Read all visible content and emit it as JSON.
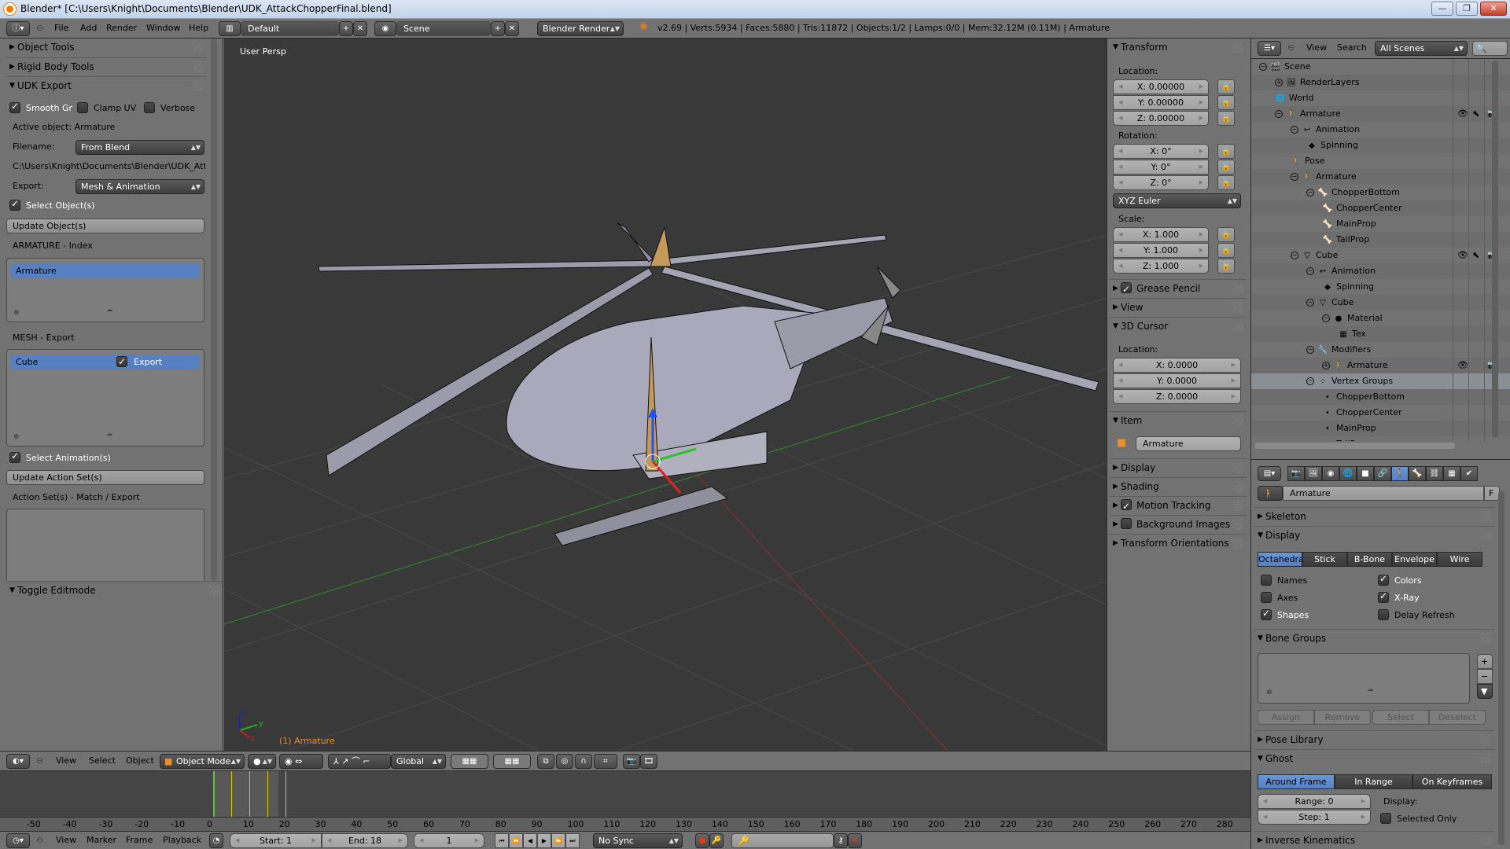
{
  "window": {
    "title": "Blender* [C:\\Users\\Knight\\Documents\\Blender\\UDK_AttackChopperFinal.blend]",
    "minimize": "—",
    "maximize": "❐",
    "close": "✕"
  },
  "topbar": {
    "menus": [
      "File",
      "Add",
      "Render",
      "Window",
      "Help"
    ],
    "layout": "Default",
    "scene": "Scene",
    "engine": "Blender Render",
    "status": "v2.69 | Verts:5934 | Faces:5880 | Tris:11872 | Objects:1/2 | Lamps:0/0 | Mem:32.12M (0.11M) | Armature"
  },
  "toolshelf": {
    "panels": {
      "object_tools": "Object Tools",
      "rigid_body_tools": "Rigid Body Tools",
      "udk_export": "UDK Export",
      "toggle_editmode": "Toggle Editmode"
    },
    "smooth_gr": {
      "label": "Smooth Gr",
      "checked": true
    },
    "clamp_uv": {
      "label": "Clamp UV",
      "checked": false
    },
    "verbose": {
      "label": "Verbose",
      "checked": false
    },
    "active_object": "Active object: Armature",
    "filename_label": "Filename:",
    "filename_value": "From Blend",
    "path": "C:\\Users\\Knight\\Documents\\Blender\\UDK_Attack",
    "export_label": "Export:",
    "export_value": "Mesh & Animation",
    "select_objects": {
      "label": "Select Object(s)",
      "checked": true
    },
    "update_objects": "Update Object(s)",
    "armature_index_label": "ARMATURE - Index",
    "armature_list": [
      "Armature"
    ],
    "mesh_export_label": "MESH - Export",
    "mesh_list": [
      {
        "name": "Cube",
        "export_label": "Export",
        "checked": true
      }
    ],
    "select_animations": {
      "label": "Select Animation(s)",
      "checked": true
    },
    "update_action_sets": "Update Action Set(s)",
    "action_sets_label": "Action Set(s) - Match / Export"
  },
  "viewport": {
    "view_name": "User Persp",
    "active_label": "(1) Armature",
    "axis": {
      "x": "x",
      "y": "y",
      "z": "z"
    }
  },
  "npanel": {
    "transform": "Transform",
    "location_label": "Location:",
    "location": [
      "X: 0.00000",
      "Y: 0.00000",
      "Z: 0.00000"
    ],
    "rotation_label": "Rotation:",
    "rotation": [
      "X: 0°",
      "Y: 0°",
      "Z: 0°"
    ],
    "rotation_mode": "XYZ Euler",
    "scale_label": "Scale:",
    "scale": [
      "X: 1.000",
      "Y: 1.000",
      "Z: 1.000"
    ],
    "grease_pencil": {
      "label": "Grease Pencil",
      "checked": true
    },
    "view": "View",
    "cursor": "3D Cursor",
    "cursor_location_label": "Location:",
    "cursor_location": [
      "X: 0.0000",
      "Y: 0.0000",
      "Z: 0.0000"
    ],
    "item": "Item",
    "item_name": "Armature",
    "display": "Display",
    "shading": "Shading",
    "motion_tracking": {
      "label": "Motion Tracking",
      "checked": true
    },
    "background_images": {
      "label": "Background Images",
      "checked": false
    },
    "transform_orientations": "Transform Orientations"
  },
  "v3dheader": {
    "menus": [
      "View",
      "Select",
      "Object"
    ],
    "mode": "Object Mode",
    "orientation": "Global"
  },
  "timeline": {
    "ticks": [
      "-50",
      "-40",
      "-30",
      "-20",
      "-10",
      "0",
      "10",
      "20",
      "30",
      "40",
      "50",
      "60",
      "70",
      "80",
      "90",
      "100",
      "110",
      "120",
      "130",
      "140",
      "150",
      "160",
      "170",
      "180",
      "190",
      "200",
      "210",
      "220",
      "230",
      "240",
      "250",
      "260",
      "270",
      "280"
    ],
    "menus": [
      "View",
      "Marker",
      "Frame",
      "Playback"
    ],
    "start": "Start: 1",
    "end": "End: 18",
    "current": "1",
    "sync": "No Sync",
    "current_frame": 1,
    "keyframes": [
      0,
      5,
      10,
      15,
      20
    ]
  },
  "outliner": {
    "menus": [
      "View",
      "Search"
    ],
    "filter": "All Scenes",
    "rows": [
      {
        "label": "Scene",
        "icon": "🎬",
        "depth": 0,
        "exp": "−"
      },
      {
        "label": "RenderLayers",
        "icon": "🖼",
        "depth": 1,
        "exp": "+"
      },
      {
        "label": "World",
        "icon": "🌐",
        "depth": 1,
        "exp": ""
      },
      {
        "label": "Armature",
        "icon": "🚶",
        "depth": 1,
        "exp": "−",
        "vis": true
      },
      {
        "label": "Animation",
        "icon": "↩",
        "depth": 2,
        "exp": "−"
      },
      {
        "label": "Spinning",
        "icon": "◆",
        "depth": 3,
        "exp": ""
      },
      {
        "label": "Pose",
        "icon": "🚶",
        "depth": 2,
        "exp": ""
      },
      {
        "label": "Armature",
        "icon": "🚶",
        "depth": 2,
        "exp": "−"
      },
      {
        "label": "ChopperBottom",
        "icon": "🦴",
        "depth": 3,
        "exp": "−"
      },
      {
        "label": "ChopperCenter",
        "icon": "🦴",
        "depth": 4,
        "exp": ""
      },
      {
        "label": "MainProp",
        "icon": "🦴",
        "depth": 4,
        "exp": ""
      },
      {
        "label": "TailProp",
        "icon": "🦴",
        "depth": 4,
        "exp": ""
      },
      {
        "label": "Cube",
        "icon": "▽",
        "depth": 2,
        "exp": "−",
        "vis": true
      },
      {
        "label": "Animation",
        "icon": "↩",
        "depth": 3,
        "exp": "−"
      },
      {
        "label": "Spinning",
        "icon": "◆",
        "depth": 4,
        "exp": ""
      },
      {
        "label": "Cube",
        "icon": "▽",
        "depth": 3,
        "exp": "−"
      },
      {
        "label": "Material",
        "icon": "●",
        "depth": 4,
        "exp": "−"
      },
      {
        "label": "Tex",
        "icon": "▦",
        "depth": 5,
        "exp": ""
      },
      {
        "label": "Modifiers",
        "icon": "🔧",
        "depth": 3,
        "exp": "−"
      },
      {
        "label": "Armature",
        "icon": "🚶",
        "depth": 4,
        "exp": "+",
        "vis": true,
        "modvis": true
      },
      {
        "label": "Vertex Groups",
        "icon": "⁘",
        "depth": 3,
        "exp": "−",
        "sel": true
      },
      {
        "label": "ChopperBottom",
        "icon": "•",
        "depth": 4,
        "exp": ""
      },
      {
        "label": "ChopperCenter",
        "icon": "•",
        "depth": 4,
        "exp": ""
      },
      {
        "label": "MainProp",
        "icon": "•",
        "depth": 4,
        "exp": ""
      },
      {
        "label": "TailProp",
        "icon": "•",
        "depth": 4,
        "exp": ""
      }
    ]
  },
  "properties": {
    "tabs": [
      "render",
      "render-layers",
      "scene",
      "world",
      "object",
      "constraints",
      "data",
      "bone",
      "bone-constraints",
      "texture",
      "physics"
    ],
    "active_tab": "data",
    "datablock": "Armature",
    "fake_user": "F",
    "skeleton": "Skeleton",
    "display": "Display",
    "display_types": [
      "Octahedral",
      "Stick",
      "B-Bone",
      "Envelope",
      "Wire"
    ],
    "display_active": "Octahedral",
    "options": [
      {
        "label": "Names",
        "checked": false
      },
      {
        "label": "Colors",
        "checked": true
      },
      {
        "label": "Axes",
        "checked": false
      },
      {
        "label": "X-Ray",
        "checked": true
      },
      {
        "label": "Shapes",
        "checked": true
      },
      {
        "label": "Delay Refresh",
        "checked": false
      }
    ],
    "bone_groups": "Bone Groups",
    "bg_buttons": [
      "Assign",
      "Remove",
      "Select",
      "Deselect"
    ],
    "pose_library": "Pose Library",
    "ghost": "Ghost",
    "ghost_types": [
      "Around Frame",
      "In Range",
      "On Keyframes"
    ],
    "ghost_active": "Around Frame",
    "range": "Range: 0",
    "step": "Step: 1",
    "display_label": "Display:",
    "selected_only": {
      "label": "Selected Only",
      "checked": false
    },
    "inverse_kinematics": "Inverse Kinematics"
  }
}
